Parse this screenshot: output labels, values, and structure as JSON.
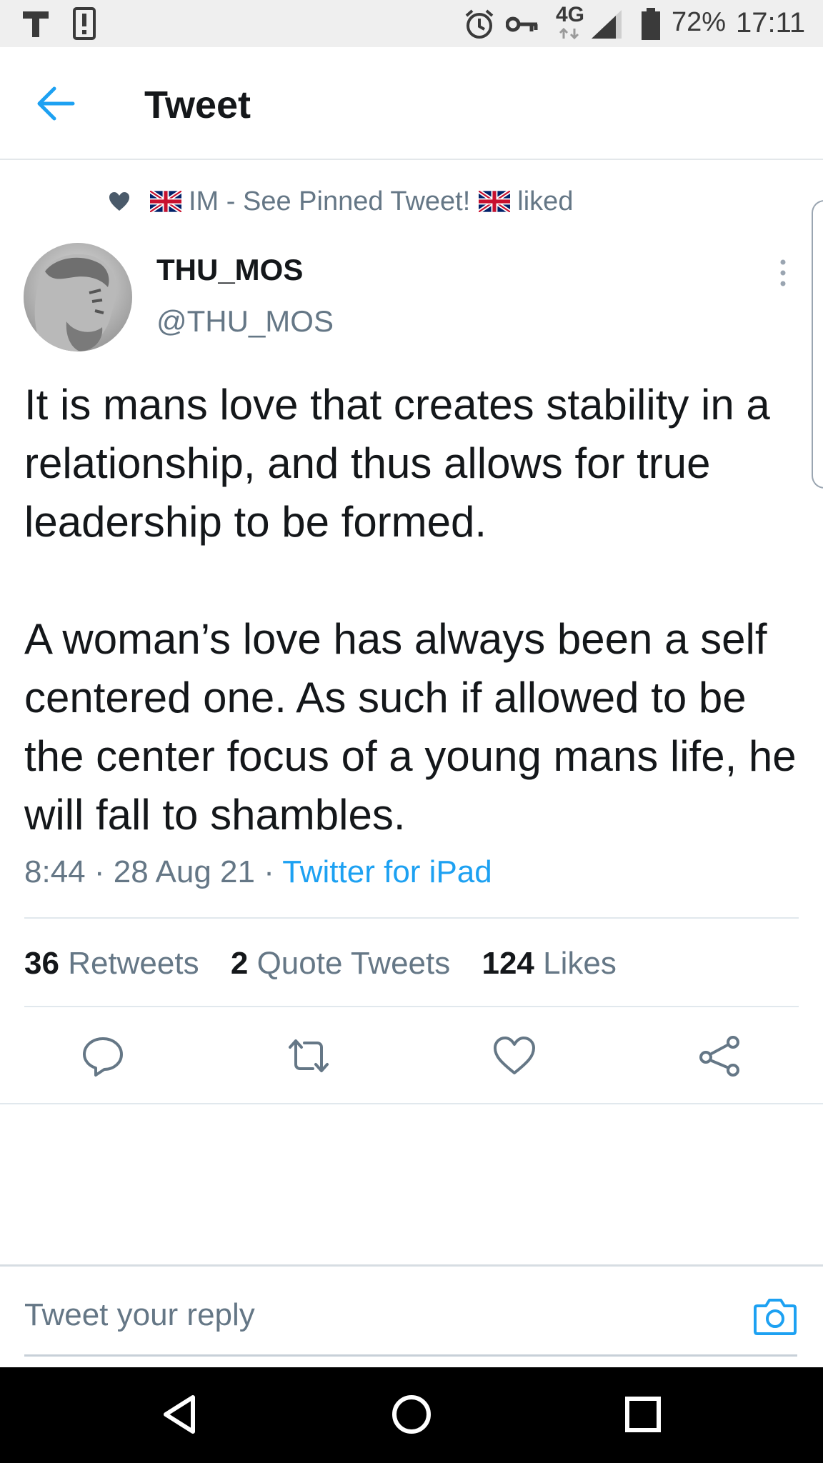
{
  "status_bar": {
    "left_icons": [
      "t-app-icon",
      "alert-icon"
    ],
    "right_icons": [
      "alarm-icon",
      "key-icon",
      "network-4g-icon",
      "signal-icon",
      "battery-icon"
    ],
    "network": "4G",
    "battery": "72%",
    "time": "17:11"
  },
  "header": {
    "title": "Tweet"
  },
  "social_context": {
    "liker": "IM - See Pinned Tweet!",
    "action": "liked"
  },
  "tweet": {
    "author_name": "THU_MOS",
    "author_handle": "@THU_MOS",
    "paragraph_1": "It is mans love that creates stability in a relationship, and thus allows for true leadership to be formed.",
    "paragraph_2": "A woman’s love has always been a self centered one. As such if allowed to be the center focus of a young mans life, he will fall to shambles.",
    "time": "8:44",
    "date": "28 Aug 21",
    "separator": "·",
    "source": "Twitter for iPad"
  },
  "stats": {
    "retweets_count": "36",
    "retweets_label": "Retweets",
    "quotes_count": "2",
    "quotes_label": "Quote Tweets",
    "likes_count": "124",
    "likes_label": "Likes"
  },
  "actions": [
    "reply-icon",
    "retweet-icon",
    "like-icon",
    "share-icon"
  ],
  "reply": {
    "placeholder": "Tweet your reply"
  },
  "colors": {
    "accent": "#1da1f2",
    "secondary_text": "#657786",
    "primary_text": "#14171a",
    "divider": "#e1e8ed"
  }
}
